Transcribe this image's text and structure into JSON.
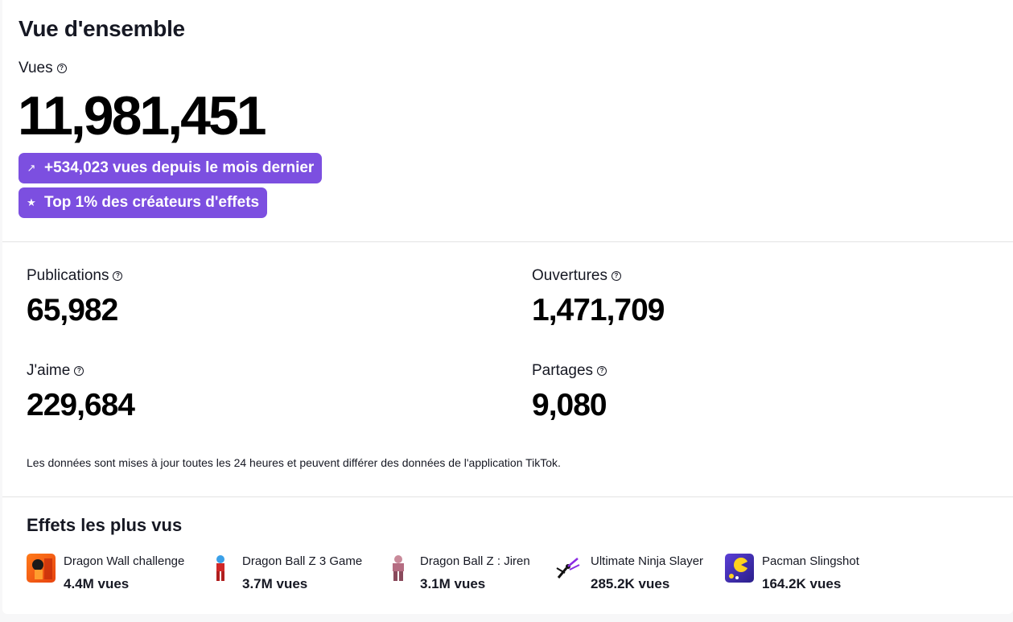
{
  "overview": {
    "title": "Vue d'ensemble",
    "views_label": "Vues",
    "views_value": "11,981,451",
    "growth_badge": {
      "icon": "arrow-up-right-icon",
      "text": "+534,023 vues depuis le mois dernier"
    },
    "rank_badge": {
      "icon": "star-icon",
      "text": "Top 1% des créateurs d'effets"
    },
    "accent_color": "#7c4fe0"
  },
  "stats": {
    "publications": {
      "label": "Publications",
      "value": "65,982"
    },
    "opens": {
      "label": "Ouvertures",
      "value": "1,471,709"
    },
    "likes": {
      "label": "J'aime",
      "value": "229,684"
    },
    "shares": {
      "label": "Partages",
      "value": "9,080"
    }
  },
  "disclaimer": "Les données sont mises à jour toutes les 24 heures et peuvent différer des données de l'application TikTok.",
  "top_effects": {
    "title": "Effets les plus vus",
    "items": [
      {
        "name": "Dragon Wall challenge",
        "views": "4.4M vues"
      },
      {
        "name": "Dragon Ball Z 3 Game",
        "views": "3.7M vues"
      },
      {
        "name": "Dragon Ball Z : Jiren",
        "views": "3.1M vues"
      },
      {
        "name": "Ultimate Ninja Slayer",
        "views": "285.2K vues"
      },
      {
        "name": "Pacman Slingshot",
        "views": "164.2K vues"
      }
    ]
  }
}
